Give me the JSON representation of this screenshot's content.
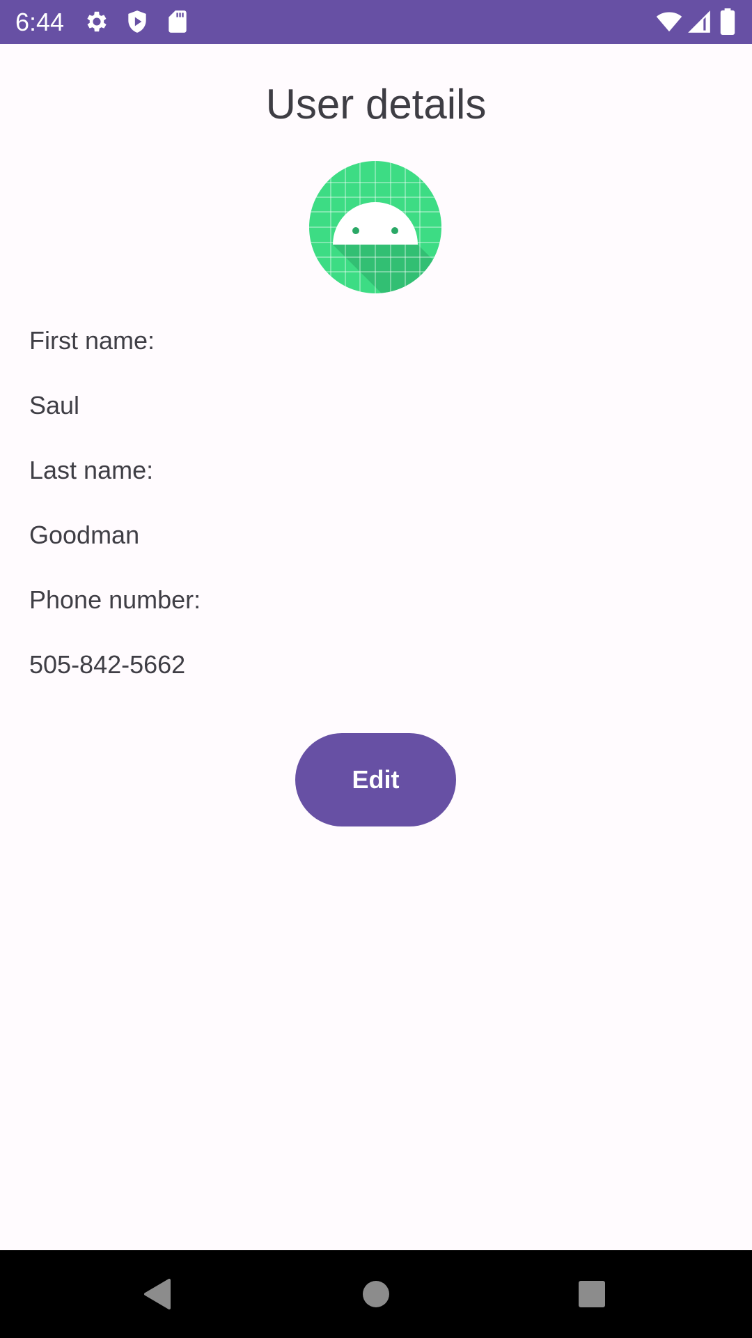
{
  "status_bar": {
    "time": "6:44",
    "icons": [
      "settings-icon",
      "shield-icon",
      "sd-card-icon",
      "wifi-icon",
      "cellular-signal-icon",
      "battery-icon"
    ],
    "background": "#6750a4"
  },
  "screen": {
    "title": "User details",
    "avatar_icon": "android-robot-icon"
  },
  "fields": [
    {
      "label": "First name:",
      "value": "Saul"
    },
    {
      "label": "Last name:",
      "value": "Goodman"
    },
    {
      "label": "Phone number:",
      "value": "505-842-5662"
    }
  ],
  "actions": {
    "edit_label": "Edit"
  },
  "nav_bar": {
    "buttons": [
      "back-icon",
      "home-icon",
      "recents-icon"
    ]
  },
  "colors": {
    "primary": "#6750a4",
    "background": "#fffbfe",
    "avatar_green": "#3ddc84"
  }
}
